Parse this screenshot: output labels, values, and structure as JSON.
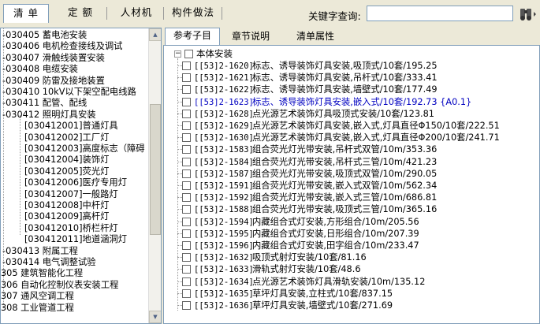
{
  "toolbar": {
    "tabs": [
      "清 单",
      "定 额",
      "人材机",
      "构件做法"
    ],
    "keyword_label": "关键字查询:",
    "keyword_value": ""
  },
  "left_tree": {
    "rows": [
      {
        "code": "030405",
        "label": "蓄电池安装",
        "prefix": "-030405"
      },
      {
        "code": "030406",
        "label": "电机检查接线及调试",
        "prefix": "-030406"
      },
      {
        "code": "030407",
        "label": "滑触线装置安装",
        "prefix": "-030407"
      },
      {
        "code": "030408",
        "label": "电缆安装",
        "prefix": "-030408"
      },
      {
        "code": "030409",
        "label": "防雷及接地装置",
        "prefix": "-030409"
      },
      {
        "code": "030410",
        "label": "10kV以下架空配电线路",
        "prefix": "-030410"
      },
      {
        "code": "030411",
        "label": "配管、配线",
        "prefix": "-030411"
      },
      {
        "code": "030412",
        "label": "照明灯具安装",
        "prefix": "-030412"
      },
      {
        "code": "[030412001]",
        "label": "普通灯具"
      },
      {
        "code": "[030412002]",
        "label": "工厂灯"
      },
      {
        "code": "[030412003]",
        "label": "高度标志（障碍"
      },
      {
        "code": "[030412004]",
        "label": "装饰灯"
      },
      {
        "code": "[030412005]",
        "label": "荧光灯"
      },
      {
        "code": "[030412006]",
        "label": "医疗专用灯"
      },
      {
        "code": "[030412007]",
        "label": "一般路灯"
      },
      {
        "code": "[030412008]",
        "label": "中杆灯"
      },
      {
        "code": "[030412009]",
        "label": "高杆灯"
      },
      {
        "code": "[030412010]",
        "label": "桥栏杆灯"
      },
      {
        "code": "[030412011]",
        "label": "地道涵洞灯"
      },
      {
        "code": "030413",
        "label": "附属工程",
        "prefix": "-030413"
      },
      {
        "code": "030414",
        "label": "电气调整试验",
        "prefix": "-030414"
      },
      {
        "code": "305",
        "label": "建筑智能化工程",
        "prefix": "305"
      },
      {
        "code": "306",
        "label": "自动化控制仪表安装工程",
        "prefix": "306"
      },
      {
        "code": "307",
        "label": "通风空调工程",
        "prefix": "307"
      },
      {
        "code": "308",
        "label": "工业管道工程",
        "prefix": "308"
      }
    ]
  },
  "right_panel": {
    "tabs": [
      "参考子目",
      "章节说明",
      "清单属性"
    ],
    "root_label": "本体安装",
    "items": [
      {
        "code": "[[53]2-1620]",
        "desc": "标志、诱导装饰灯具安装,吸顶式/10套/195.25"
      },
      {
        "code": "[[53]2-1621]",
        "desc": "标志、诱导装饰灯具安装,吊杆式/10套/333.41"
      },
      {
        "code": "[[53]2-1622]",
        "desc": "标志、诱导装饰灯具安装,墙壁式/10套/177.49"
      },
      {
        "code": "[[53]2-1623]",
        "desc": "标志、诱导装饰灯具安装,嵌入式/10套/192.73 {A0.1}"
      },
      {
        "code": "[[53]2-1628]",
        "desc": "点光源艺术装饰灯具吸顶式安装/10套/123.81"
      },
      {
        "code": "[[53]2-1629]",
        "desc": "点光源艺术装饰灯具安装,嵌入式,灯具直径Φ150/10套/222.51"
      },
      {
        "code": "[[53]2-1630]",
        "desc": "点光源艺术装饰灯具安装,嵌入式,灯具直径Φ200/10套/241.71"
      },
      {
        "code": "[[53]2-1583]",
        "desc": "组合荧光灯光带安装,吊杆式双管/10m/353.36"
      },
      {
        "code": "[[53]2-1584]",
        "desc": "组合荧光灯光带安装,吊杆式三管/10m/421.23"
      },
      {
        "code": "[[53]2-1587]",
        "desc": "组合荧光灯光带安装,吸顶式双管/10m/290.05"
      },
      {
        "code": "[[53]2-1591]",
        "desc": "组合荧光灯光带安装,嵌入式双管/10m/562.34"
      },
      {
        "code": "[[53]2-1592]",
        "desc": "组合荧光灯光带安装,嵌入式三管/10m/686.81"
      },
      {
        "code": "[[53]2-1588]",
        "desc": "组合荧光灯光带安装,吸顶式三管/10m/365.16"
      },
      {
        "code": "[[53]2-1594]",
        "desc": "内藏组合式灯安装,方形组合/10m/205.56"
      },
      {
        "code": "[[53]2-1595]",
        "desc": "内藏组合式灯安装,日形组合/10m/207.39"
      },
      {
        "code": "[[53]2-1596]",
        "desc": "内藏组合式灯安装,田字组合/10m/233.47"
      },
      {
        "code": "[[53]2-1632]",
        "desc": "吸顶式射灯安装/10套/81.16"
      },
      {
        "code": "[[53]2-1633]",
        "desc": "滑轨式射灯安装/10套/48.6"
      },
      {
        "code": "[[53]2-1634]",
        "desc": "点光源艺术装饰灯具滑轨安装/10m/135.12"
      },
      {
        "code": "[[53]2-1635]",
        "desc": "草坪灯具安装,立柱式/10套/837.15"
      },
      {
        "code": "[[53]2-1636]",
        "desc": "草坪灯具安装,墙壁式/10套/271.69"
      }
    ]
  },
  "colors": {
    "highlight_text": "#0000c0",
    "border": "#7f9db9",
    "chrome": "#ece9d8"
  }
}
